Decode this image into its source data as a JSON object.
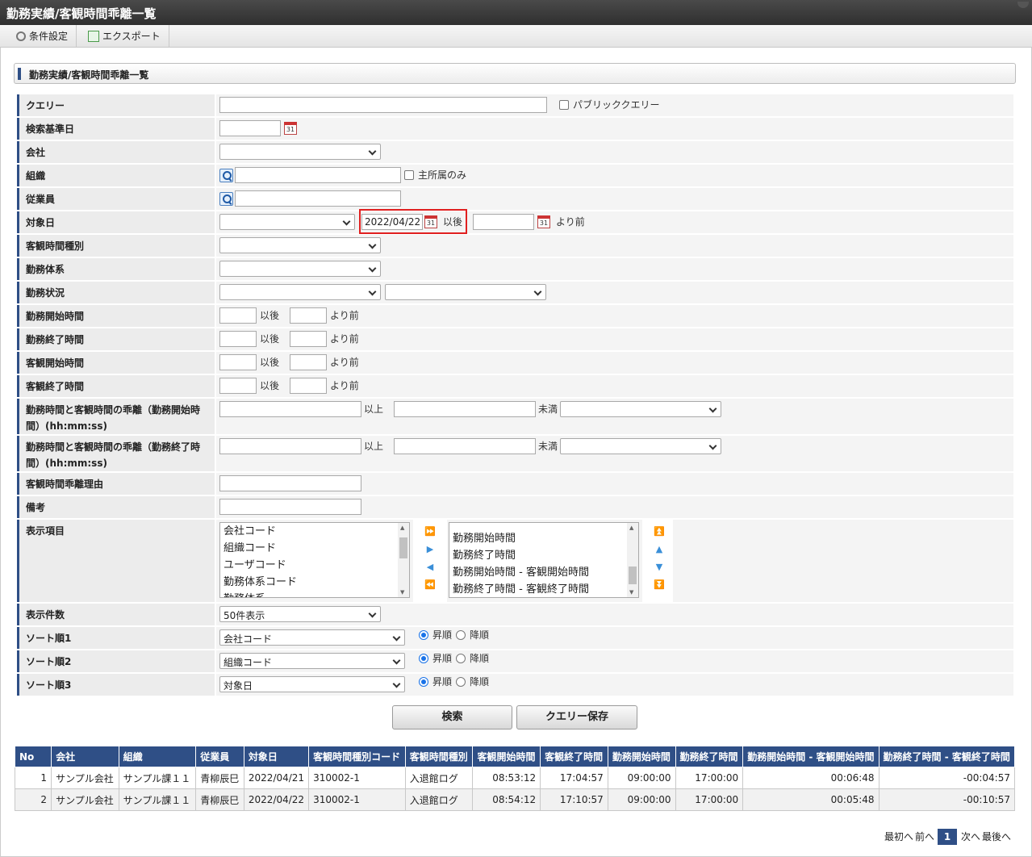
{
  "window": {
    "title": "勤務実績/客観時間乖離一覧"
  },
  "toolbar": {
    "conditions": "条件設定",
    "export": "エクスポート"
  },
  "panel": {
    "title": "勤務実績/客観時間乖離一覧"
  },
  "form": {
    "query_label": "クエリー",
    "public_query": "パブリッククエリー",
    "base_date_label": "検索基準日",
    "company_label": "会社",
    "org_label": "組織",
    "main_org_only": "主所属のみ",
    "employee_label": "従業員",
    "target_date_label": "対象日",
    "target_date_from": "2022/04/22",
    "after": "以後",
    "before": "より前",
    "obj_time_type_label": "客観時間種別",
    "work_system_label": "勤務体系",
    "work_status_label": "勤務状況",
    "work_start_label": "勤務開始時間",
    "work_end_label": "勤務終了時間",
    "obj_start_label": "客観開始時間",
    "obj_end_label": "客観終了時間",
    "gap_start_label": "勤務時間と客観時間の乖離（勤務開始時間）(hh:mm:ss)",
    "gap_end_label": "勤務時間と客観時間の乖離（勤務終了時間）(hh:mm:ss)",
    "over": "以上",
    "under": "未満",
    "gap_reason_label": "客観時間乖離理由",
    "note_label": "備考",
    "display_items_label": "表示項目",
    "available_items": [
      "会社コード",
      "組織コード",
      "ユーザコード",
      "勤務体系コード",
      "勤務体系"
    ],
    "selected_items": [
      "勤務開始時間",
      "勤務終了時間",
      "勤務開始時間 - 客観開始時間",
      "勤務終了時間 - 客観終了時間"
    ],
    "count_label": "表示件数",
    "count_value": "50件表示",
    "sort1_label": "ソート順1",
    "sort1_value": "会社コード",
    "sort2_label": "ソート順2",
    "sort2_value": "組織コード",
    "sort3_label": "ソート順3",
    "sort3_value": "対象日",
    "asc": "昇順",
    "desc": "降順"
  },
  "buttons": {
    "search": "検索",
    "save_query": "クエリー保存"
  },
  "table": {
    "headers": [
      "No",
      "会社",
      "組織",
      "従業員",
      "対象日",
      "客観時間種別コード",
      "客観時間種別",
      "客観開始時間",
      "客観終了時間",
      "勤務開始時間",
      "勤務終了時間",
      "勤務開始時間 - 客観開始時間",
      "勤務終了時間 - 客観終了時間"
    ],
    "rows": [
      [
        "1",
        "サンプル会社",
        "サンプル課１１",
        "青柳辰巳",
        "2022/04/21",
        "310002-1",
        "入退館ログ",
        "08:53:12",
        "17:04:57",
        "09:00:00",
        "17:00:00",
        "00:06:48",
        "-00:04:57"
      ],
      [
        "2",
        "サンプル会社",
        "サンプル課１１",
        "青柳辰巳",
        "2022/04/22",
        "310002-1",
        "入退館ログ",
        "08:54:12",
        "17:10:57",
        "09:00:00",
        "17:00:00",
        "00:05:48",
        "-00:10:57"
      ]
    ]
  },
  "pager": {
    "first": "最初へ",
    "prev": "前へ",
    "current": "1",
    "next": "次へ",
    "last": "最後へ"
  }
}
